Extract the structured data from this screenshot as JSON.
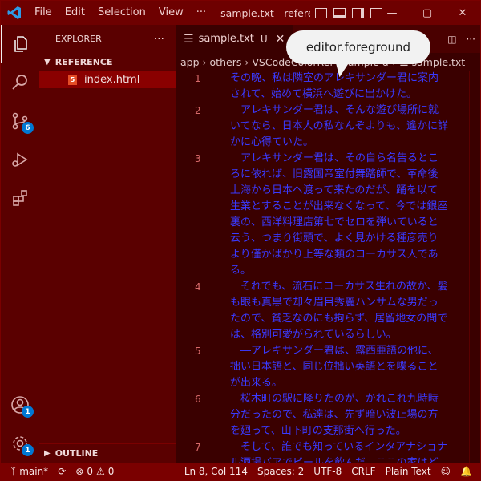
{
  "titlebar": {
    "menu": [
      "File",
      "Edit",
      "Selection",
      "View",
      "···"
    ],
    "title": "sample.txt - reference"
  },
  "activity": {
    "scm_badge": "6",
    "accounts_badge": "1",
    "settings_badge": "1"
  },
  "sidebar": {
    "header": "EXPLORER",
    "more": "···",
    "section": "REFERENCE",
    "file": "index.html",
    "outline": "OUTLINE"
  },
  "editor": {
    "tab_label": "sample.txt",
    "tab_modified": "U",
    "breadcrumb": [
      "app",
      "others",
      "VSCodeColorReference",
      "sample data",
      "sample.txt"
    ],
    "callout": "editor.foreground",
    "lines": [
      {
        "num": "1",
        "text": "その晩、私は隣室のアレキサンダー君に案内されて、始めて横浜へ遊びに出かけた。"
      },
      {
        "num": "2",
        "text": "　アレキサンダー君は、そんな遊び場所に就いてなら、日本人の私なんぞよりも、遙かに詳かに心得ていた。"
      },
      {
        "num": "3",
        "text": "　アレキサンダー君は、その自ら名告るところに依れば、旧露国帝室付舞踏師で、革命後上海から日本へ渡って来たのだが、踊を以て生業とすることが出来なくなって、今では銀座裏の、西洋料理店第七でセロを弾いていると云う、つまり街頭で、よく見かける種彦売りより僅かばかり上等な類のコーカサス人である。"
      },
      {
        "num": "4",
        "text": "　それでも、流石にコーカサス生れの故か、髪も眼も真黒で却々眉目秀麗ハンサムな男だったので、貧乏なのにも拘らず、居留地女の間では、格別可愛がられているらしい。"
      },
      {
        "num": "5",
        "text": "　―アレキサンダー君は、露西亜語の他に、拙い日本語と、同じ位拙い英語とを喋ることが出来る。"
      },
      {
        "num": "6",
        "text": "　桜木町の駅に降りたのが、かれこれ九時時分だったので、私達は、先ず暗い波止場の方を廻って、山下町の支那街へ行った。"
      },
      {
        "num": "7",
        "text": "　そして、誰でも知っているインタアナショナル酒場バアでビールを飲んだ。ここの家はどう云う理由か、エビス・ビールを看板にしている。"
      }
    ]
  },
  "statusbar": {
    "branch": "main*",
    "errors": "0",
    "warnings": "0",
    "position": "Ln 8, Col 114",
    "spaces": "Spaces: 2",
    "encoding": "UTF-8",
    "eol": "CRLF",
    "language": "Plain Text"
  },
  "colors": {
    "accent": "#6e0000",
    "sidebar": "#5a0000",
    "editor_bg": "#3a0000",
    "foreground": "#3a3aff",
    "line_number": "#d86a6a"
  }
}
